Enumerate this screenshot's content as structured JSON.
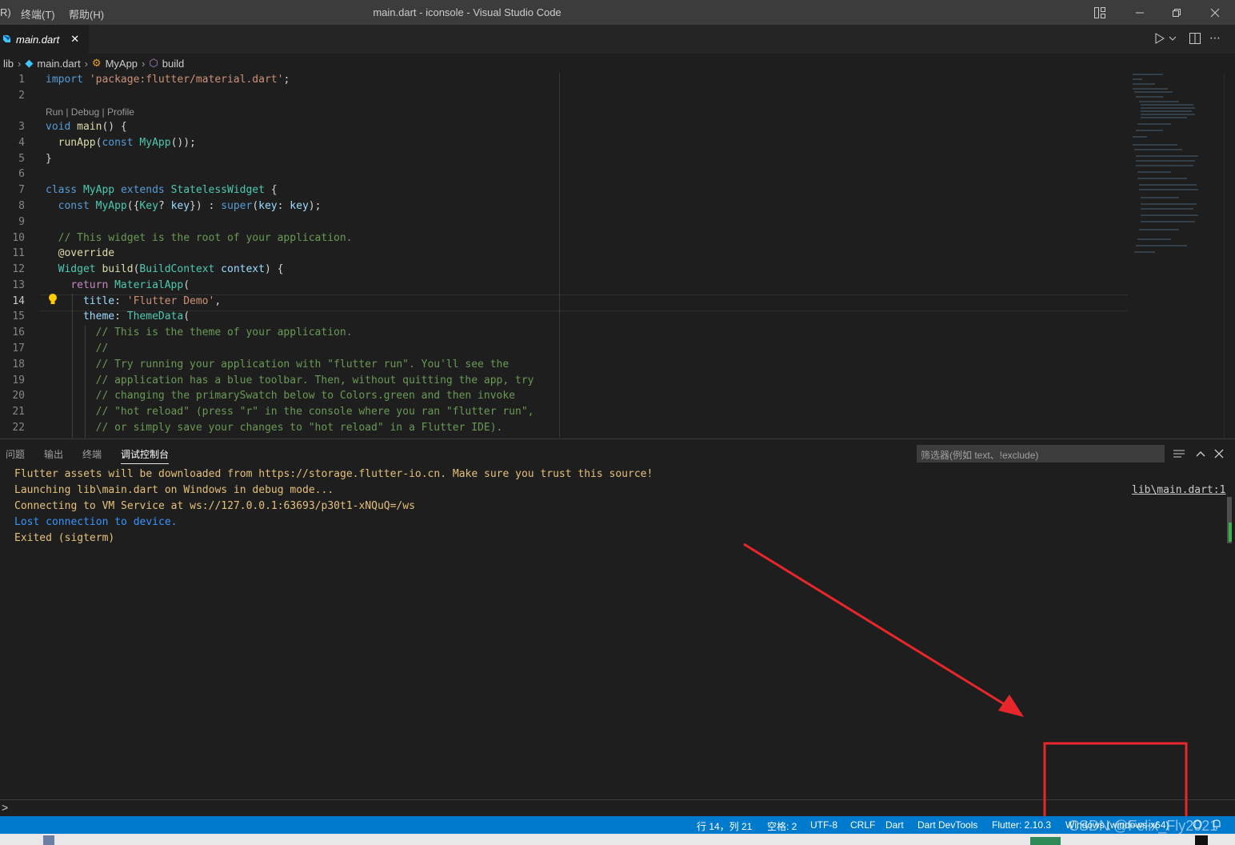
{
  "window": {
    "title": "main.dart - iconsole - Visual Studio Code",
    "menu": [
      "R)",
      "终端(T)",
      "帮助(H)"
    ]
  },
  "tabs": [
    {
      "label": "main.dart",
      "close": "✕"
    }
  ],
  "breadcrumb": [
    "lib",
    "main.dart",
    "MyApp",
    "build"
  ],
  "editor": {
    "line_numbers": [
      "1",
      "2",
      "3",
      "4",
      "5",
      "6",
      "7",
      "8",
      "9",
      "10",
      "11",
      "12",
      "13",
      "14",
      "15",
      "16",
      "17",
      "18",
      "19",
      "20",
      "21",
      "22"
    ],
    "codelens": "Run | Debug | Profile",
    "current_line": "14"
  },
  "panel": {
    "tabs": [
      "问题",
      "输出",
      "终端",
      "调试控制台"
    ],
    "active_tab": "调试控制台",
    "filter_placeholder": "筛选器(例如 text、!exclude)",
    "output": [
      {
        "text": "Flutter assets will be downloaded from https://storage.flutter-io.cn. Make sure you trust this source!",
        "color": "#e5c07b"
      },
      {
        "text": "Launching lib\\main.dart on Windows in debug mode...",
        "color": "#e5c07b"
      },
      {
        "text": "Connecting to VM Service at ws://127.0.0.1:63693/p30t1-xNQuQ=/ws",
        "color": "#e5c07b"
      },
      {
        "text": "Lost connection to device.",
        "color": "#3794ff"
      },
      {
        "text": "Exited (sigterm)",
        "color": "#e5c07b"
      }
    ],
    "source_link": "lib\\main.dart:1",
    "prompt": ">"
  },
  "statusbar": {
    "position": "行 14，列 21",
    "spaces": "空格: 2",
    "encoding": "UTF-8",
    "eol": "CRLF",
    "language": "Dart",
    "devtools": "Dart DevTools",
    "flutter": "Flutter: 2.10.3",
    "device": "Windows (windows-x64)"
  },
  "watermark": "CSDN @Felix_Fly2021",
  "colors": {
    "status_bar": "#007acc",
    "annotation": "#e8262b"
  }
}
